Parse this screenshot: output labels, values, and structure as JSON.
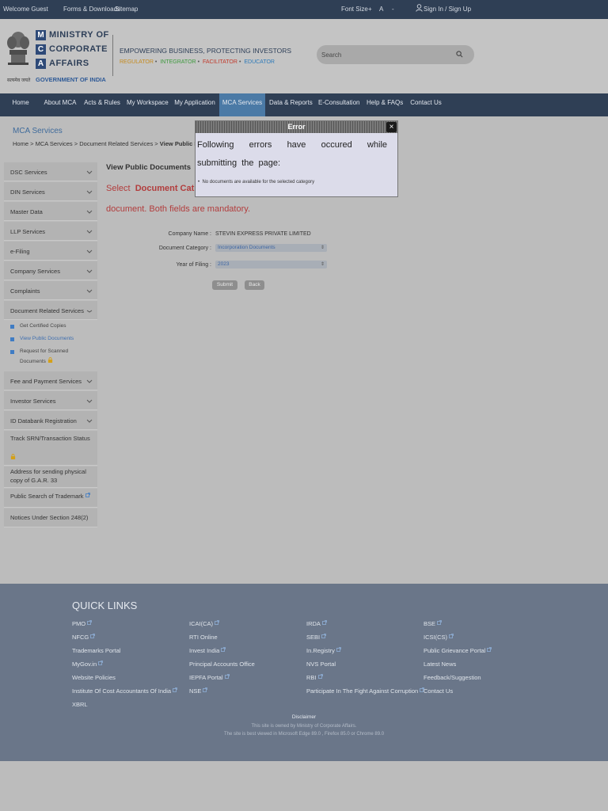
{
  "topbar": {
    "welcome": "Welcome Guest",
    "forms": "Forms & Downloads",
    "sitemap": "Sitemap",
    "font_size": "Font Size",
    "font_plus": "+",
    "font_normal": "A",
    "font_minus": "-",
    "signin": "Sign In / Sign Up"
  },
  "header": {
    "ministry_letters": [
      "M",
      "C",
      "A"
    ],
    "ministry_words": [
      "MINISTRY OF",
      "CORPORATE",
      "AFFAIRS"
    ],
    "gov": "GOVERNMENT OF INDIA",
    "emblem_text": "सत्यमेव जयते",
    "tagline": "EMPOWERING BUSINESS, PROTECTING INVESTORS",
    "roles": [
      {
        "label": "REGULATOR",
        "color": "#c58a1e"
      },
      {
        "label": "INTEGRATOR",
        "color": "#3e9a3e"
      },
      {
        "label": "FACILITATOR",
        "color": "#c0392b"
      },
      {
        "label": "EDUCATOR",
        "color": "#2e7ab8"
      }
    ],
    "search_placeholder": "Search"
  },
  "nav": {
    "items": [
      "Home",
      "About MCA",
      "Acts & Rules",
      "My Workspace",
      "My Application",
      "MCA Services",
      "Data & Reports",
      "E-Consultation",
      "Help & FAQs",
      "Contact Us"
    ],
    "active": "MCA Services"
  },
  "page": {
    "title": "MCA Services",
    "breadcrumb": [
      "Home",
      "MCA Services",
      "Document Related Services",
      "View Public Do"
    ]
  },
  "sidebar": {
    "items": [
      "DSC Services",
      "DIN Services",
      "Master Data",
      "LLP Services",
      "e-Filing",
      "Company Services",
      "Complaints",
      "Document Related Services"
    ],
    "sub_items": [
      "Get Certified Copies",
      "View Public Documents",
      "Request for Scanned",
      "Documents"
    ],
    "items2": [
      "Fee and Payment Services",
      "Investor Services",
      "ID Databank Registration"
    ],
    "track": "Track SRN/Transaction Status",
    "address": [
      "Address for sending physical",
      "copy of G.A.R. 33"
    ],
    "trademark": "Public Search of Trademark",
    "notices": "Notices Under Section 248(2)"
  },
  "main": {
    "title": "View Public Documents",
    "select_prefix": "Select",
    "select_bold": "Document  Cat",
    "select_line2": "document. Both fields are mandatory.",
    "company_label": "Company Name :",
    "company_value": "STEVIN EXPRESS PRIVATE LIMITED",
    "category_label": "Document Category :",
    "category_value": "Incorporation Documents",
    "year_label": "Year of Filing :",
    "year_value": "2023",
    "submit": "Submit",
    "back": "Back"
  },
  "dialog": {
    "title": "Error",
    "close": "×",
    "message": "Following errors have occured while submitting the page:",
    "bullet": "No documents are available for the selected category"
  },
  "footer": {
    "title": "QUICK LINKS",
    "col1": [
      "PMO",
      "NFCG",
      "Trademarks Portal",
      "MyGov.in",
      "Website Policies",
      "Institute Of Cost Accountants Of India",
      "XBRL"
    ],
    "col2": [
      "ICAI(CA)",
      "RTI Online",
      "Invest India",
      "Principal Accounts Office",
      "IEPFA Portal",
      "NSE"
    ],
    "col3": [
      "IRDA",
      "SEBI",
      "In.Registry",
      "NVS Portal",
      "RBI",
      "Participate In The Fight Against Corruption"
    ],
    "col4": [
      "BSE",
      "ICSI(CS)",
      "Public Grievance Portal",
      "Latest News",
      "Feedback/Suggestion",
      "Contact Us"
    ],
    "disclaimer": "Disclaimer",
    "note1": "This site is owned by Ministry of Corporate Affairs.",
    "note2": "The site is best viewed in Microsoft Edge 89.0 , Firefox 85.0 or Chrome 89.0"
  },
  "colors": {
    "navy": "#2f3f55",
    "active_tab": "#4b7aa6",
    "error_red": "#b23d3d",
    "footer": "#6a7689"
  }
}
